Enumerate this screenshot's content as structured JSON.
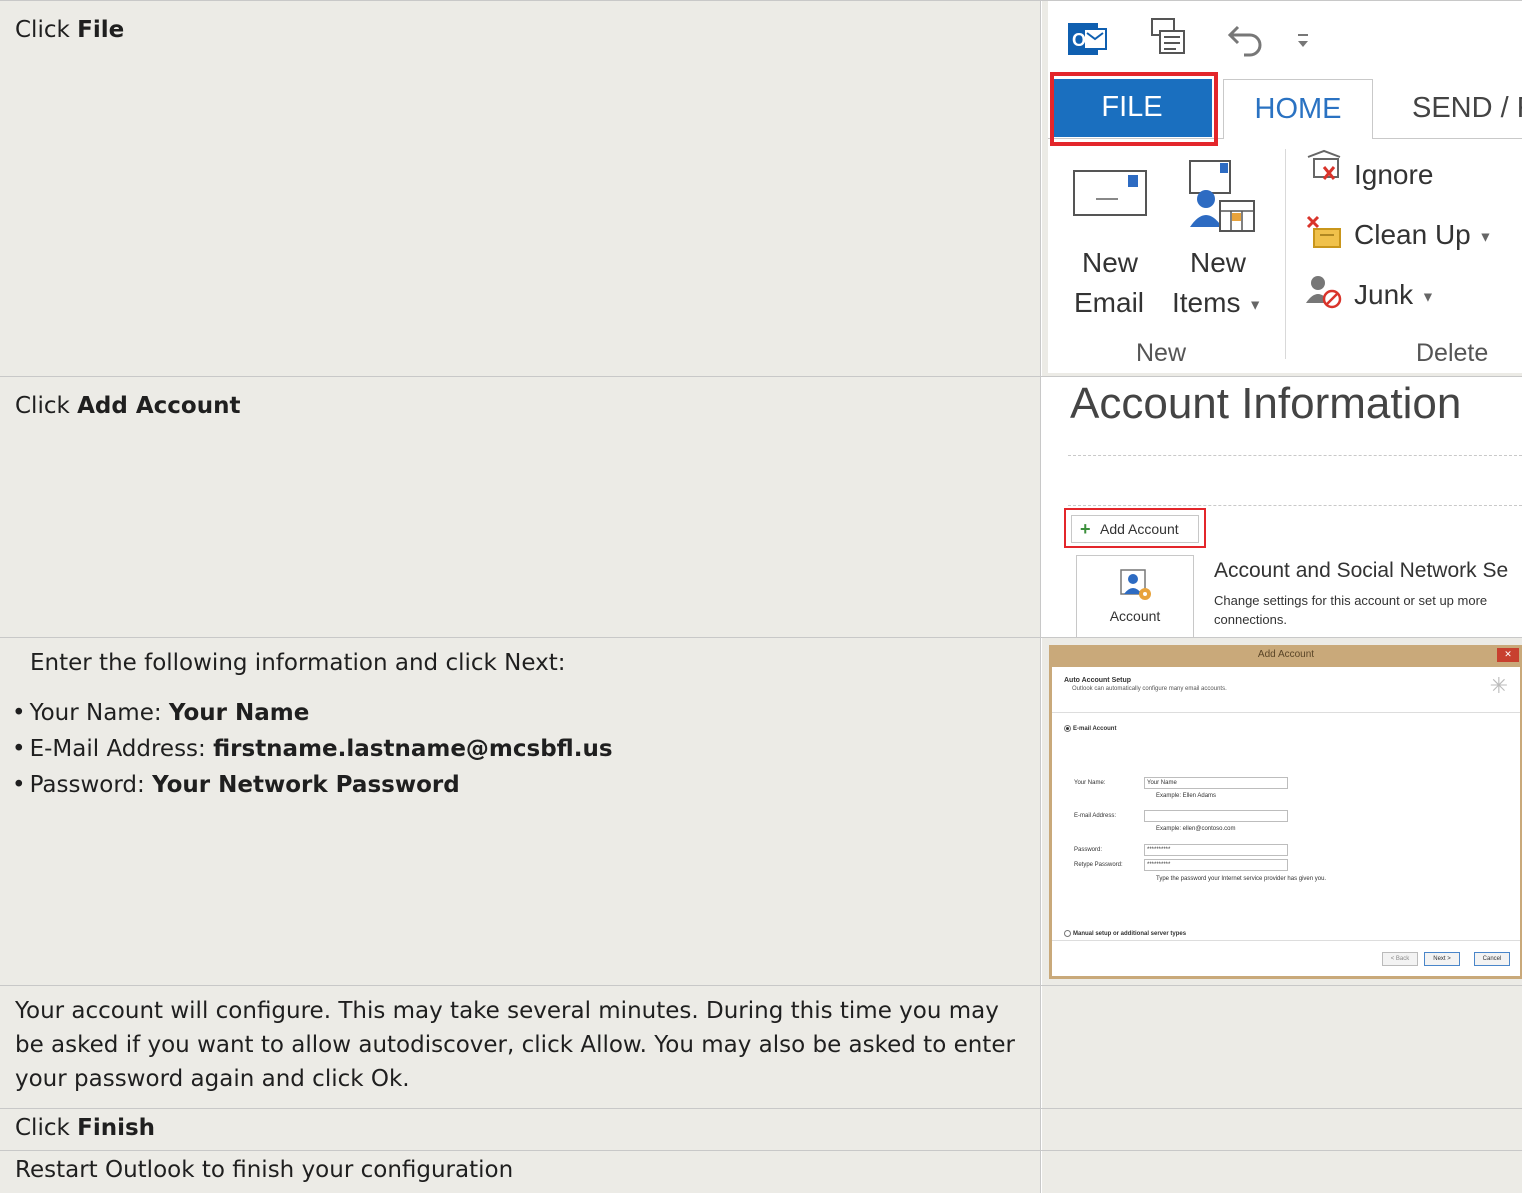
{
  "steps": [
    {
      "instruction_prefix": "Click ",
      "instruction_bold": "File",
      "ribbon": {
        "tabs": [
          "FILE",
          "HOME",
          "SEND / R"
        ],
        "buttons": {
          "new_email": [
            "New",
            "Email"
          ],
          "new_items": [
            "New",
            "Items"
          ],
          "ignore": "Ignore",
          "clean_up": "Clean Up",
          "junk": "Junk"
        },
        "groups": [
          "New",
          "Delete"
        ]
      }
    },
    {
      "instruction_prefix": "Click ",
      "instruction_bold": "Add Account",
      "account_info": {
        "title": "Account Information",
        "add_account": "Add Account",
        "account_settings_label": "Account",
        "section_title": "Account and Social Network Se",
        "section_desc": "Change settings for this account or set up more connections."
      }
    },
    {
      "intro": "Enter the following information and click Next:",
      "bullets": [
        {
          "label": "Your Name: ",
          "value": "Your Name"
        },
        {
          "label": "E-Mail Address: ",
          "value": "firstname.lastname@mcsbfl.us"
        },
        {
          "label": "Password: ",
          "value": "Your Network Password"
        }
      ],
      "dialog": {
        "title": "Add Account",
        "close": "✕",
        "heading": "Auto Account Setup",
        "subheading": "Outlook can automatically configure many email accounts.",
        "email_account_option": "E-mail Account",
        "your_name_label": "Your Name:",
        "your_name_value": "Your Name",
        "your_name_example": "Example: Ellen Adams",
        "email_label": "E-mail Address:",
        "email_example": "Example: ellen@contoso.com",
        "password_label": "Password:",
        "password_value": "**********",
        "retype_label": "Retype Password:",
        "retype_value": "**********",
        "password_hint": "Type the password your Internet service provider has given you.",
        "manual_option": "Manual setup or additional server types",
        "back_button": "< Back",
        "next_button": "Next >",
        "cancel_button": "Cancel"
      }
    },
    {
      "text": "Your account will configure. This may take several minutes. During this time you may be asked if you want to allow autodiscover, click Allow. You may also be asked to enter your password again and click Ok."
    },
    {
      "instruction_prefix": "Click ",
      "instruction_bold": "Finish"
    },
    {
      "text": "Restart Outlook to finish your configuration"
    }
  ],
  "colors": {
    "cell_bg": "#ecebe6",
    "file_tab_blue": "#1a6fbf",
    "highlight_red": "#e3262b"
  }
}
